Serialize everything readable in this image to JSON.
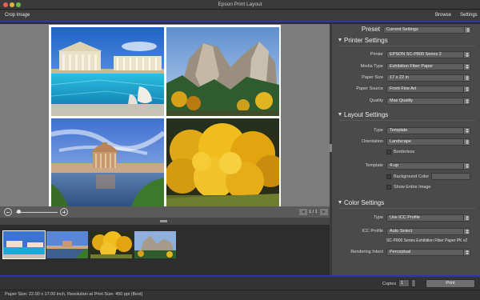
{
  "window": {
    "title": "Epson Print Layout"
  },
  "toolbar": {
    "crop_image": "Crop Image",
    "browse": "Browse",
    "settings": "Settings"
  },
  "zoom": {
    "page_indicator": "1 / 1",
    "prev_icon": "chevron-left-icon",
    "next_icon": "chevron-right-icon",
    "level": 0.05
  },
  "photos": [
    {
      "name": "pool-colonnade",
      "icon": "photo-thumbnail"
    },
    {
      "name": "granite-peaks-autumn",
      "icon": "photo-thumbnail"
    },
    {
      "name": "rotunda-lagoon",
      "icon": "photo-thumbnail"
    },
    {
      "name": "golden-tree",
      "icon": "photo-thumbnail"
    }
  ],
  "preset": {
    "label": "Preset",
    "value": "Current Settings"
  },
  "printer_settings": {
    "title": "Printer Settings",
    "printer": {
      "label": "Printer",
      "value": "EPSON SC-P800 Series 2"
    },
    "media_type": {
      "label": "Media Type",
      "value": "Exhibition Fiber Paper"
    },
    "paper_size": {
      "label": "Paper Size",
      "value": "17 x 22 in"
    },
    "paper_source": {
      "label": "Paper Source",
      "value": "Front Fine Art"
    },
    "quality": {
      "label": "Quality",
      "value": "Max Quality"
    }
  },
  "layout_settings": {
    "title": "Layout Settings",
    "type": {
      "label": "Type",
      "value": "Template"
    },
    "orientation": {
      "label": "Orientation",
      "value": "Landscape"
    },
    "borderless": {
      "label": "Borderless",
      "checked": false
    },
    "template": {
      "label": "Template",
      "value": "4-up"
    },
    "background_color": {
      "label": "Background Color",
      "checked": false
    },
    "show_entire_image": {
      "label": "Show Entire Image",
      "checked": false
    }
  },
  "color_settings": {
    "title": "Color Settings",
    "type": {
      "label": "Type",
      "value": "Use ICC Profile"
    },
    "icc_profile": {
      "label": "ICC Profile",
      "value": "Auto Select"
    },
    "icc_info": "SC-P800 Series Exhibition Fiber Paper PK v2",
    "rendering_intent": {
      "label": "Rendering Intent",
      "value": "Perceptual"
    }
  },
  "print_panel": {
    "copies_label": "Copies",
    "copies_value": "1",
    "print_button": "Print"
  },
  "status": {
    "text": "Paper Size: 22.00 x 17.00 inch,   Resolution at Print Size: 450 ppi (Best)"
  },
  "colors": {
    "accent_line": "#2f37a8",
    "sidebar_bg": "#4a4a4a",
    "canvas_bg": "#7c7c7c"
  }
}
